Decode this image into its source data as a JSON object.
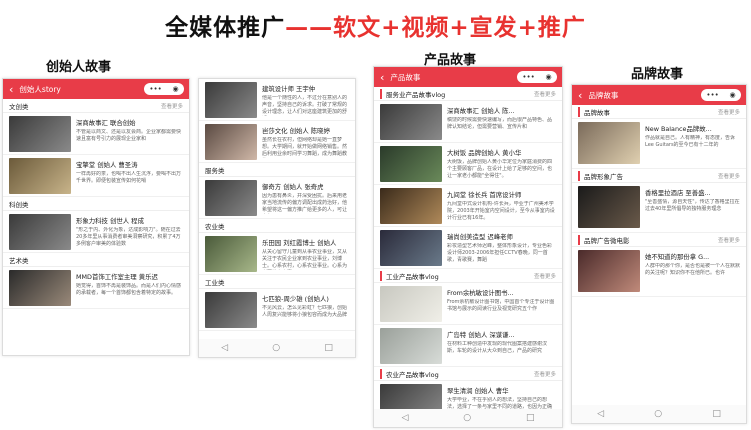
{
  "title_part1": "全媒体推广",
  "title_part2": "——软文+视频+宣发+推广",
  "labels": {
    "founder": "创始人故事",
    "product": "产品故事",
    "brand": "品牌故事"
  },
  "phone1": {
    "bar_title": "创始人story",
    "more": "查看更多",
    "sections": [
      {
        "name": "文创类",
        "items": [
          {
            "head": "深商故事汇 联合创始",
            "desc": "不管是以商文、还是以友会商。企业家都需要快速且富有号引力的展现企业家和"
          },
          {
            "head": "宝擎堂 创始人 曹圣涛",
            "desc": "一样再好的茶，也喝不出人生沉浮，要喝不出万千世界。即便包装宣传如何花哨"
          }
        ]
      },
      {
        "name": "科创类",
        "items": [
          {
            "head": "形象力科技 创世人 程成",
            "desc": "\"形之于内、外化为象，达成影响力\"。随在过去20多年里从事消费者审美洞察研究，积累了4万多例客户审美的体验数"
          }
        ]
      },
      {
        "name": "艺术类",
        "items": [
          {
            "head": "MMD首饰工作室主理 黄乐迟",
            "desc": "她觉得，首饰不再是装饰品。而是人们内心情感的承载者，每一个首饰都包含着特定的故事。"
          }
        ]
      }
    ]
  },
  "phone1b": {
    "items_top": [
      {
        "head": "建筑设计师 王宇仲",
        "desc": "他是一个随性的人，不过分在意别人的声音，坚持自己的诉求。打破了常规的设计理念，让人们对这座建筑更加的舒适。"
      },
      {
        "head": "岜莎文化 创始人 陈晓婷",
        "desc": "虽然长在农村，但网络却是她一直梦想。大学期间，就开始做网络销售。然后利用业余时间学习舞蹈，成为舞蹈教练"
      }
    ],
    "sections": [
      {
        "name": "服务类",
        "items": [
          {
            "head": "御奇方 创始人 张奇虎",
            "desc": "因为患有鼻炎，并深受困扰。后来用老家当地流传的偏方调配出成药治好，他希望将这一偏方推广给更多的人，可让患友"
          }
        ]
      },
      {
        "name": "农业类",
        "items": [
          {
            "head": "乐田园 刘红霞博士 创始人",
            "desc": "从关心留守儿童到从事农业事业，又从关注于农民企业家到农业事业，刘博士。心系农村，心系农业事业。心系为老百姓办实事"
          }
        ]
      },
      {
        "name": "工业类",
        "items": [
          {
            "head": "七匹狼-周少雄 (创始人)",
            "desc": "不见风云，怎么见彩虹？七匹狼，创始人周复兴能够将小狼包容而成为大品牌"
          }
        ]
      }
    ]
  },
  "phone2": {
    "bar_title": "产品故事",
    "more": "查看更多",
    "sections": [
      {
        "name": "服务业产品故事vlog",
        "items": [
          {
            "head": "深商故事汇 创始人 陈...",
            "desc": "稿饶的时候需要快速编写，而后很产品特色、品牌认知结论，但需要营销、宣传片和"
          },
          {
            "head": "大树饭 品牌创始人 黄小华",
            "desc": "大树饭，品牌创始人黄小华定位为家庭消费的四个主要顾客厂品，在设计上给了足够的空间，也让一家老小都能\"全得住\"。"
          },
          {
            "head": "九间堂 徐长兵 首席设计师",
            "desc": "九间堂中式设计机构-许长兵，毕业于广州美术学院，2003年开始室内空间设计，至今从事室内设计行业已有16年。"
          },
          {
            "head": "瑞尚创美造型 迟峰老师",
            "desc": "彩妆造型艺术师迟峰，整体形象设计，专业色彩设计师2003-2006年担任CCTV春晚，同一首歌，青歌赛，舞蹈"
          }
        ]
      },
      {
        "name": "工业产品故事vlog",
        "items": [
          {
            "head": "From余杭敏设计图书...",
            "desc": "From余杭敏设计图书馆，中国首个专注于设计图书馆与展示的阅读行业及视觉研究五个作"
          },
          {
            "head": "广岛特 创始人 深谋谦...",
            "desc": "在材料工种创造中发现的现代图案搭建感谢汉斯，车轮的设计从大众到自己，产品的研究"
          }
        ]
      },
      {
        "name": "农业产品故事vlog",
        "items": [
          {
            "head": "翠生清润 创始人 曹华",
            "desc": "大学毕业，不在乎别人的想法，坚持自己的想法，选择了一条与家里不同的道路，也因为正确的方向，但想走进农业"
          }
        ]
      }
    ]
  },
  "phone3": {
    "bar_title": "品牌故事",
    "more": "查看更多",
    "sections": [
      {
        "name": "品牌故事",
        "items": [
          {
            "head": "New Balance品牌故...",
            "desc": "作品就是自己。人有精神，有态度，告诉Lee Guitars的至今已有十二年的"
          }
        ]
      },
      {
        "name": "品牌形象广告",
        "items": [
          {
            "head": "香格里拉酒店 至善盛...",
            "desc": "\"至善盛情，源自天性\"，传达了香格里拉在过去40年里所倡导的独特服务理念"
          }
        ]
      },
      {
        "name": "品牌广告微电影",
        "items": [
          {
            "head": "她不知道的那份拿 G...",
            "desc": "人群中的那个你，是否也是被一个人在默默的关注呢？知识你不在他所已。也许"
          }
        ]
      }
    ]
  },
  "nav": {
    "back": "◁",
    "home": "○",
    "recent": "□"
  }
}
